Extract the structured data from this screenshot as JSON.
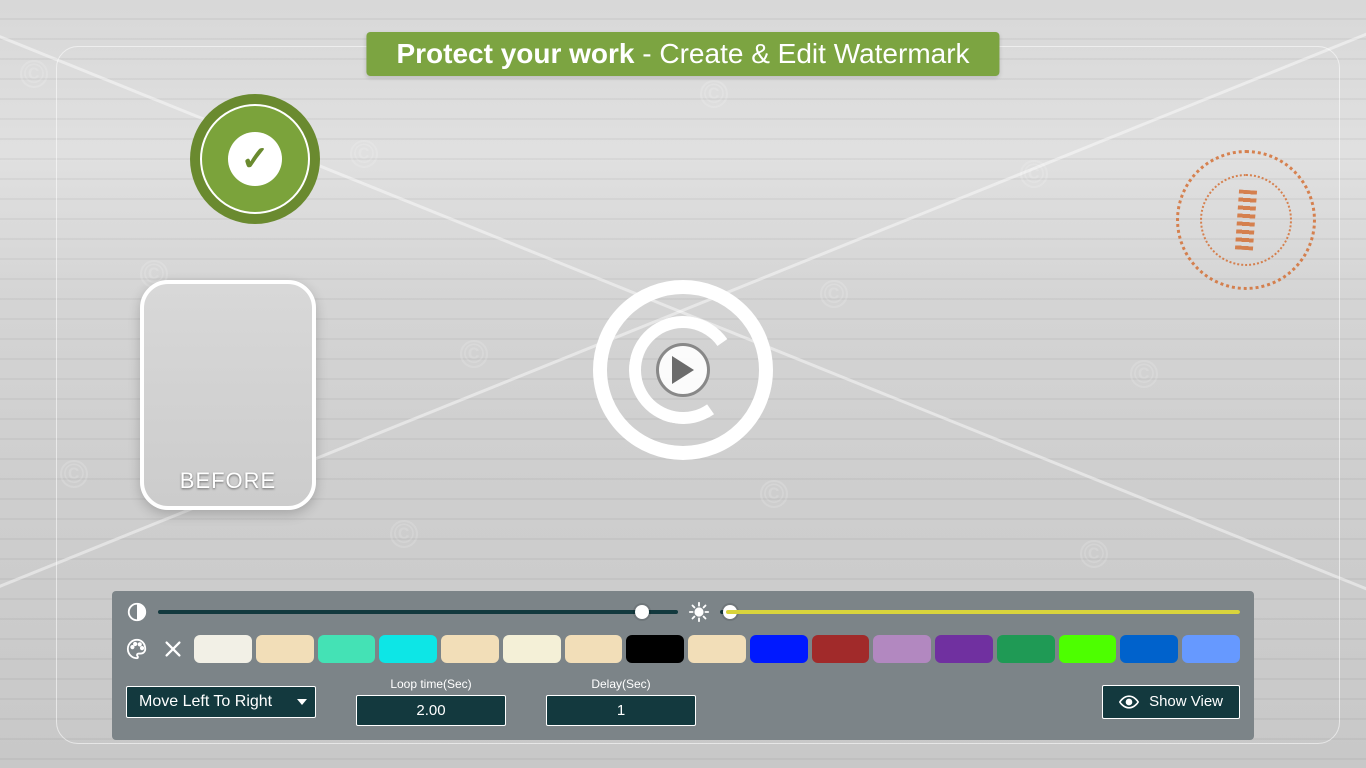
{
  "banner": {
    "bold": "Protect your work",
    "rest": " - Create & Edit Watermark"
  },
  "before_label": "BEFORE",
  "approved_text": "APPROVED",
  "pisa_text": "PISA",
  "sliders": {
    "left_value_percent": 93,
    "right_value_percent": 2
  },
  "palette": [
    "#f2f0e6",
    "#f2deb8",
    "#44e2b5",
    "#0de6e6",
    "#f2deb8",
    "#f4f0d7",
    "#f2deb8",
    "#000000",
    "#f2deb8",
    "#0019ff",
    "#a12a2a",
    "#b288c0",
    "#7030a0",
    "#1f9a55",
    "#4dff00",
    "#0062cc",
    "#6699ff"
  ],
  "animation": {
    "selected": "Move Left To Right"
  },
  "loop_time": {
    "label": "Loop time(Sec)",
    "value": "2.00"
  },
  "delay": {
    "label": "Delay(Sec)",
    "value": "1"
  },
  "show_view": "Show View"
}
